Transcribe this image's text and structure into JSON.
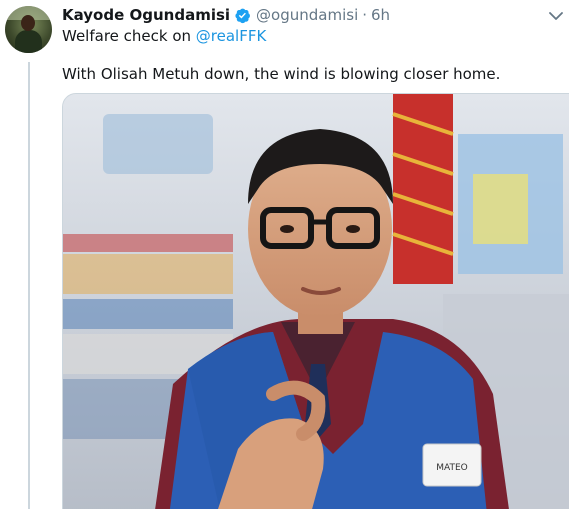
{
  "tweet": {
    "display_name": "Kayode Ogundamisi",
    "handle": "@ogundamisi",
    "separator": "·",
    "time": "6h",
    "text_prefix": "Welfare check on ",
    "mention": "@realFFK",
    "body": "With Olisah Metuh down, the wind is blowing closer home."
  },
  "media": {
    "badge_text": "MATEO"
  },
  "colors": {
    "link": "#1b95e0",
    "verified": "#1da1f2",
    "muted": "#657786",
    "vest": "#2c5fb5"
  },
  "icons": {
    "verified": "verified-badge-icon",
    "caret": "chevron-down-icon"
  }
}
